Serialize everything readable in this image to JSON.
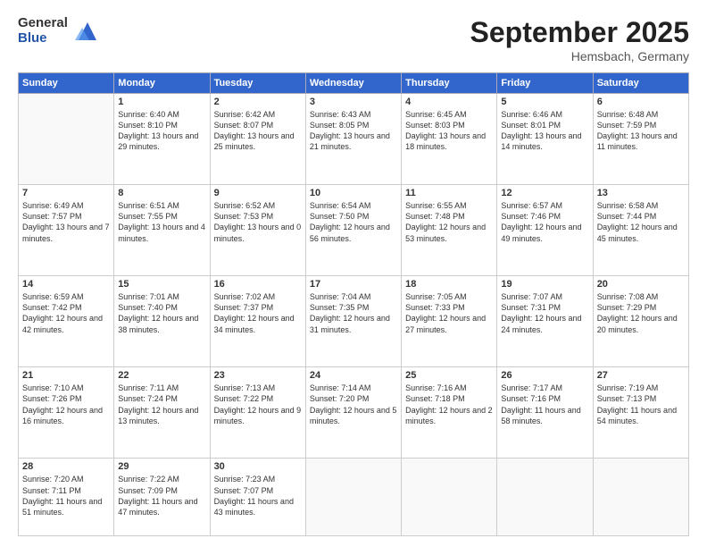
{
  "logo": {
    "general": "General",
    "blue": "Blue"
  },
  "header": {
    "month": "September 2025",
    "location": "Hemsbach, Germany"
  },
  "days_of_week": [
    "Sunday",
    "Monday",
    "Tuesday",
    "Wednesday",
    "Thursday",
    "Friday",
    "Saturday"
  ],
  "weeks": [
    [
      {
        "day": "",
        "sunrise": "",
        "sunset": "",
        "daylight": ""
      },
      {
        "day": "1",
        "sunrise": "Sunrise: 6:40 AM",
        "sunset": "Sunset: 8:10 PM",
        "daylight": "Daylight: 13 hours and 29 minutes."
      },
      {
        "day": "2",
        "sunrise": "Sunrise: 6:42 AM",
        "sunset": "Sunset: 8:07 PM",
        "daylight": "Daylight: 13 hours and 25 minutes."
      },
      {
        "day": "3",
        "sunrise": "Sunrise: 6:43 AM",
        "sunset": "Sunset: 8:05 PM",
        "daylight": "Daylight: 13 hours and 21 minutes."
      },
      {
        "day": "4",
        "sunrise": "Sunrise: 6:45 AM",
        "sunset": "Sunset: 8:03 PM",
        "daylight": "Daylight: 13 hours and 18 minutes."
      },
      {
        "day": "5",
        "sunrise": "Sunrise: 6:46 AM",
        "sunset": "Sunset: 8:01 PM",
        "daylight": "Daylight: 13 hours and 14 minutes."
      },
      {
        "day": "6",
        "sunrise": "Sunrise: 6:48 AM",
        "sunset": "Sunset: 7:59 PM",
        "daylight": "Daylight: 13 hours and 11 minutes."
      }
    ],
    [
      {
        "day": "7",
        "sunrise": "Sunrise: 6:49 AM",
        "sunset": "Sunset: 7:57 PM",
        "daylight": "Daylight: 13 hours and 7 minutes."
      },
      {
        "day": "8",
        "sunrise": "Sunrise: 6:51 AM",
        "sunset": "Sunset: 7:55 PM",
        "daylight": "Daylight: 13 hours and 4 minutes."
      },
      {
        "day": "9",
        "sunrise": "Sunrise: 6:52 AM",
        "sunset": "Sunset: 7:53 PM",
        "daylight": "Daylight: 13 hours and 0 minutes."
      },
      {
        "day": "10",
        "sunrise": "Sunrise: 6:54 AM",
        "sunset": "Sunset: 7:50 PM",
        "daylight": "Daylight: 12 hours and 56 minutes."
      },
      {
        "day": "11",
        "sunrise": "Sunrise: 6:55 AM",
        "sunset": "Sunset: 7:48 PM",
        "daylight": "Daylight: 12 hours and 53 minutes."
      },
      {
        "day": "12",
        "sunrise": "Sunrise: 6:57 AM",
        "sunset": "Sunset: 7:46 PM",
        "daylight": "Daylight: 12 hours and 49 minutes."
      },
      {
        "day": "13",
        "sunrise": "Sunrise: 6:58 AM",
        "sunset": "Sunset: 7:44 PM",
        "daylight": "Daylight: 12 hours and 45 minutes."
      }
    ],
    [
      {
        "day": "14",
        "sunrise": "Sunrise: 6:59 AM",
        "sunset": "Sunset: 7:42 PM",
        "daylight": "Daylight: 12 hours and 42 minutes."
      },
      {
        "day": "15",
        "sunrise": "Sunrise: 7:01 AM",
        "sunset": "Sunset: 7:40 PM",
        "daylight": "Daylight: 12 hours and 38 minutes."
      },
      {
        "day": "16",
        "sunrise": "Sunrise: 7:02 AM",
        "sunset": "Sunset: 7:37 PM",
        "daylight": "Daylight: 12 hours and 34 minutes."
      },
      {
        "day": "17",
        "sunrise": "Sunrise: 7:04 AM",
        "sunset": "Sunset: 7:35 PM",
        "daylight": "Daylight: 12 hours and 31 minutes."
      },
      {
        "day": "18",
        "sunrise": "Sunrise: 7:05 AM",
        "sunset": "Sunset: 7:33 PM",
        "daylight": "Daylight: 12 hours and 27 minutes."
      },
      {
        "day": "19",
        "sunrise": "Sunrise: 7:07 AM",
        "sunset": "Sunset: 7:31 PM",
        "daylight": "Daylight: 12 hours and 24 minutes."
      },
      {
        "day": "20",
        "sunrise": "Sunrise: 7:08 AM",
        "sunset": "Sunset: 7:29 PM",
        "daylight": "Daylight: 12 hours and 20 minutes."
      }
    ],
    [
      {
        "day": "21",
        "sunrise": "Sunrise: 7:10 AM",
        "sunset": "Sunset: 7:26 PM",
        "daylight": "Daylight: 12 hours and 16 minutes."
      },
      {
        "day": "22",
        "sunrise": "Sunrise: 7:11 AM",
        "sunset": "Sunset: 7:24 PM",
        "daylight": "Daylight: 12 hours and 13 minutes."
      },
      {
        "day": "23",
        "sunrise": "Sunrise: 7:13 AM",
        "sunset": "Sunset: 7:22 PM",
        "daylight": "Daylight: 12 hours and 9 minutes."
      },
      {
        "day": "24",
        "sunrise": "Sunrise: 7:14 AM",
        "sunset": "Sunset: 7:20 PM",
        "daylight": "Daylight: 12 hours and 5 minutes."
      },
      {
        "day": "25",
        "sunrise": "Sunrise: 7:16 AM",
        "sunset": "Sunset: 7:18 PM",
        "daylight": "Daylight: 12 hours and 2 minutes."
      },
      {
        "day": "26",
        "sunrise": "Sunrise: 7:17 AM",
        "sunset": "Sunset: 7:16 PM",
        "daylight": "Daylight: 11 hours and 58 minutes."
      },
      {
        "day": "27",
        "sunrise": "Sunrise: 7:19 AM",
        "sunset": "Sunset: 7:13 PM",
        "daylight": "Daylight: 11 hours and 54 minutes."
      }
    ],
    [
      {
        "day": "28",
        "sunrise": "Sunrise: 7:20 AM",
        "sunset": "Sunset: 7:11 PM",
        "daylight": "Daylight: 11 hours and 51 minutes."
      },
      {
        "day": "29",
        "sunrise": "Sunrise: 7:22 AM",
        "sunset": "Sunset: 7:09 PM",
        "daylight": "Daylight: 11 hours and 47 minutes."
      },
      {
        "day": "30",
        "sunrise": "Sunrise: 7:23 AM",
        "sunset": "Sunset: 7:07 PM",
        "daylight": "Daylight: 11 hours and 43 minutes."
      },
      {
        "day": "",
        "sunrise": "",
        "sunset": "",
        "daylight": ""
      },
      {
        "day": "",
        "sunrise": "",
        "sunset": "",
        "daylight": ""
      },
      {
        "day": "",
        "sunrise": "",
        "sunset": "",
        "daylight": ""
      },
      {
        "day": "",
        "sunrise": "",
        "sunset": "",
        "daylight": ""
      }
    ]
  ]
}
